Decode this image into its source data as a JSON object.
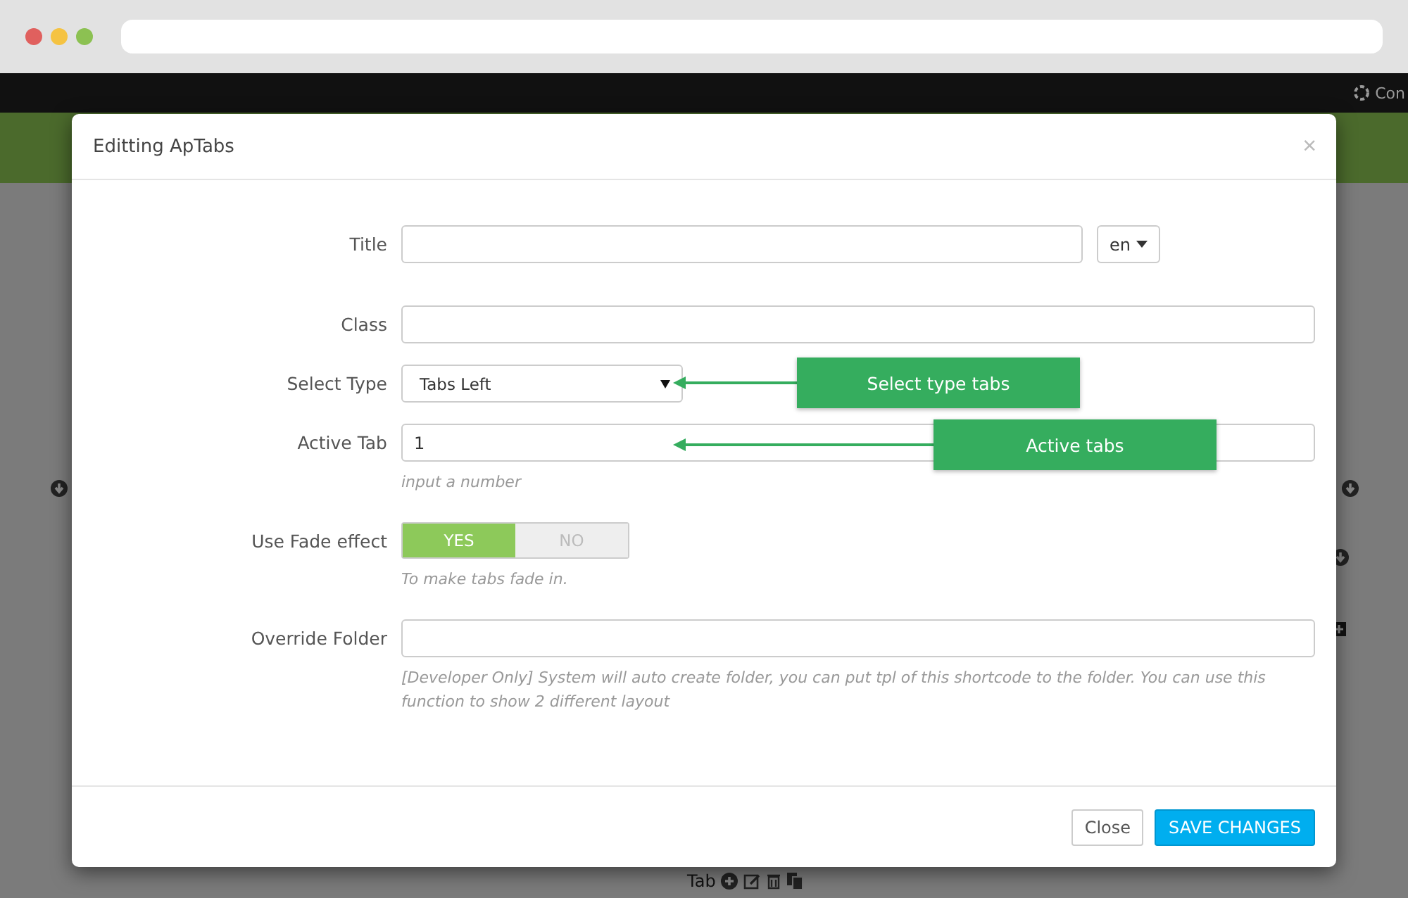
{
  "background": {
    "top_bar_link": "Con",
    "footer_label": "Tab"
  },
  "modal": {
    "title": "Editting ApTabs",
    "close": "×",
    "fields": [
      {
        "kind": "text",
        "label": "Title",
        "language": "en"
      },
      {
        "kind": "text",
        "label": "Class"
      },
      {
        "kind": "select",
        "label": "Select Type",
        "value": "Tabs Left",
        "callout": "Select type tabs"
      },
      {
        "kind": "text",
        "label": "Active Tab",
        "value": "1",
        "help": "input a number",
        "callout": "Active tabs"
      },
      {
        "kind": "toggle",
        "label": "Use Fade effect",
        "options": [
          {
            "label": "YES",
            "selected": true
          },
          {
            "label": "NO",
            "selected": false
          }
        ],
        "help": "To make tabs fade in."
      },
      {
        "kind": "text",
        "label": "Override Folder",
        "help": "[Developer Only] System will auto create folder, you can put tpl of this shortcode to the folder. You can use this function to show 2 different layout"
      }
    ],
    "buttons": [
      {
        "label": "Close",
        "kind": "default"
      },
      {
        "label": "SAVE CHANGES",
        "kind": "primary"
      }
    ]
  }
}
